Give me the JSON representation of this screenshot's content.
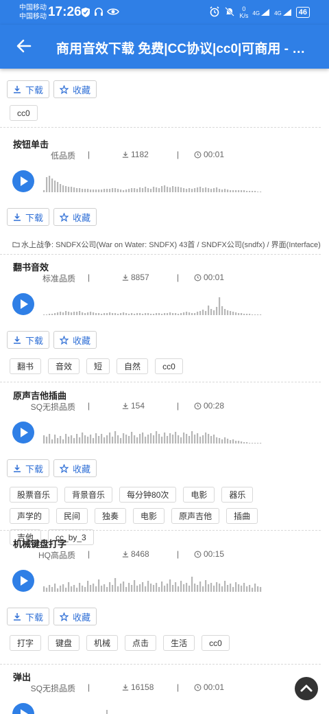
{
  "status_bar": {
    "carrier1": "中国移动",
    "carrier2": "中国移动",
    "time": "17:26",
    "net_speed_value": "0",
    "net_speed_unit": "K/s",
    "signal1": "4G",
    "signal2": "4G",
    "battery": "46"
  },
  "header": {
    "title": "商用音效下载 免费|CC协议|cc0|可商用 - …"
  },
  "actions": {
    "download": "下载",
    "favorite": "收藏"
  },
  "top": {
    "tags": [
      "cc0"
    ]
  },
  "sounds": [
    {
      "title": "按钮单击",
      "quality": "低品质",
      "downloads": "1182",
      "duration": "00:01",
      "source": "水上战争: SNDFX公司(War on Water: SNDFX) 43首 / SNDFX公司(sndfx) / 界面(Interface)",
      "tags": [],
      "wave_heights": [
        3,
        22,
        24,
        20,
        17,
        15,
        12,
        10,
        9,
        8,
        8,
        7,
        6,
        6,
        5,
        5,
        5,
        4,
        4,
        4,
        4,
        4,
        5,
        5,
        5,
        6,
        6,
        5,
        4,
        3,
        4,
        5,
        6,
        6,
        5,
        7,
        6,
        8,
        6,
        5,
        8,
        7,
        6,
        9,
        10,
        8,
        7,
        9,
        8,
        8,
        7,
        6,
        5,
        6,
        5,
        6,
        7,
        8,
        6,
        7,
        6,
        5,
        6,
        7,
        5,
        4,
        5,
        4,
        3,
        3,
        3,
        3,
        3,
        3,
        2,
        2,
        2,
        2,
        1,
        1
      ]
    },
    {
      "title": "翻书音效",
      "quality": "标准品质",
      "downloads": "8857",
      "duration": "00:01",
      "tags": [
        "翻书",
        "音效",
        "短",
        "自然",
        "cc0"
      ],
      "wave_heights": [
        1,
        1,
        2,
        2,
        3,
        4,
        5,
        4,
        6,
        5,
        4,
        5,
        5,
        6,
        4,
        3,
        4,
        5,
        4,
        3,
        3,
        2,
        3,
        3,
        4,
        3,
        3,
        2,
        3,
        4,
        3,
        2,
        3,
        2,
        3,
        3,
        2,
        3,
        3,
        2,
        2,
        3,
        3,
        2,
        3,
        3,
        4,
        3,
        3,
        2,
        3,
        4,
        5,
        4,
        3,
        3,
        5,
        6,
        8,
        6,
        14,
        9,
        7,
        12,
        26,
        13,
        9,
        7,
        6,
        5,
        4,
        3,
        3,
        2,
        2,
        2,
        1,
        1,
        1,
        1
      ]
    },
    {
      "title": "原声吉他插曲",
      "quality": "SQ无损品质",
      "downloads": "154",
      "duration": "00:28",
      "tags": [
        "股票音乐",
        "背景音乐",
        "每分钟80次",
        "电影",
        "器乐",
        "声学的",
        "民间",
        "独奏",
        "电影",
        "原声吉他",
        "插曲",
        "吉他",
        "cc_by_3"
      ],
      "wave_heights": [
        12,
        10,
        14,
        6,
        13,
        8,
        11,
        6,
        14,
        10,
        12,
        8,
        14,
        9,
        16,
        12,
        10,
        13,
        8,
        15,
        11,
        14,
        9,
        12,
        16,
        10,
        18,
        12,
        8,
        15,
        13,
        11,
        17,
        12,
        9,
        14,
        16,
        10,
        13,
        15,
        12,
        18,
        14,
        10,
        16,
        11,
        15,
        13,
        17,
        12,
        9,
        16,
        14,
        11,
        18,
        13,
        15,
        10,
        12,
        16,
        14,
        11,
        13,
        9,
        8,
        6,
        9,
        7,
        5,
        6,
        4,
        4,
        3,
        2,
        2,
        1,
        1,
        1,
        1,
        1
      ]
    },
    {
      "title": "机械键盘打字",
      "quality": "HQ高品质",
      "downloads": "8468",
      "duration": "00:15",
      "tags": [
        "打字",
        "键盘",
        "机械",
        "点击",
        "生活",
        "cc0"
      ],
      "wave_heights": [
        8,
        6,
        10,
        7,
        12,
        5,
        9,
        11,
        6,
        14,
        8,
        10,
        6,
        13,
        9,
        7,
        16,
        10,
        12,
        8,
        18,
        9,
        11,
        7,
        14,
        10,
        20,
        8,
        12,
        15,
        7,
        13,
        10,
        17,
        9,
        11,
        14,
        8,
        16,
        12,
        10,
        13,
        7,
        15,
        9,
        12,
        18,
        10,
        14,
        8,
        16,
        11,
        13,
        9,
        22,
        12,
        10,
        15,
        8,
        17,
        11,
        13,
        9,
        14,
        12,
        8,
        16,
        10,
        12,
        7,
        14,
        11,
        9,
        13,
        8,
        10,
        6,
        12,
        8,
        7
      ]
    },
    {
      "title": "弹出",
      "quality": "SQ无损品质",
      "downloads": "16158",
      "duration": "00:01",
      "tags": [],
      "wave_heights": []
    }
  ],
  "colors": {
    "primary": "#2f7fe6",
    "wave": "#b7b7b7"
  }
}
